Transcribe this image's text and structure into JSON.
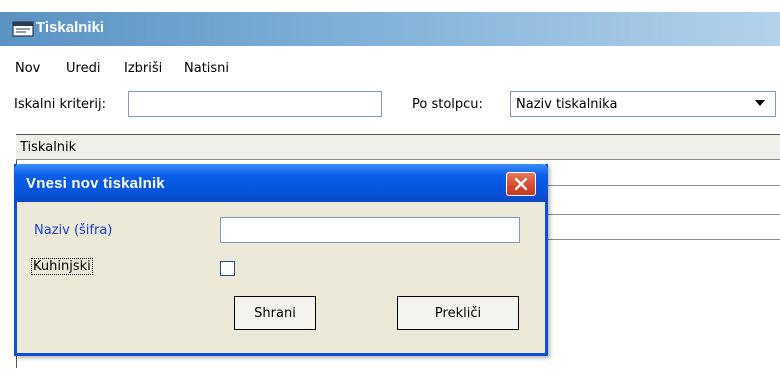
{
  "window": {
    "title": "Tiskalniki"
  },
  "menu": {
    "items": [
      "Nov",
      "Uredi",
      "Izbriši",
      "Natisni"
    ]
  },
  "search": {
    "label": "Iskalni kriterij:",
    "value": "",
    "column_label": "Po stolpcu:",
    "column_selected": "Naziv tiskalnika"
  },
  "table": {
    "columns": [
      "Tiskalnik"
    ]
  },
  "dialog": {
    "title": "Vnesi nov tiskalnik",
    "name_label": "Naziv (šifra)",
    "name_value": "",
    "kitchen_label": "Kuhinjski",
    "kitchen_checked": false,
    "save_label": "Shrani",
    "cancel_label": "Prekliči"
  },
  "colors": {
    "main_title_gradient_start": "#5a92c2",
    "dialog_title_blue": "#0654dc",
    "close_button_red": "#d5472b",
    "field_label_blue": "#1a3fd6",
    "dialog_body": "#ece9d8"
  },
  "icons": {
    "window": "printer-window-icon",
    "close": "close-icon",
    "dropdown": "chevron-down-icon"
  }
}
